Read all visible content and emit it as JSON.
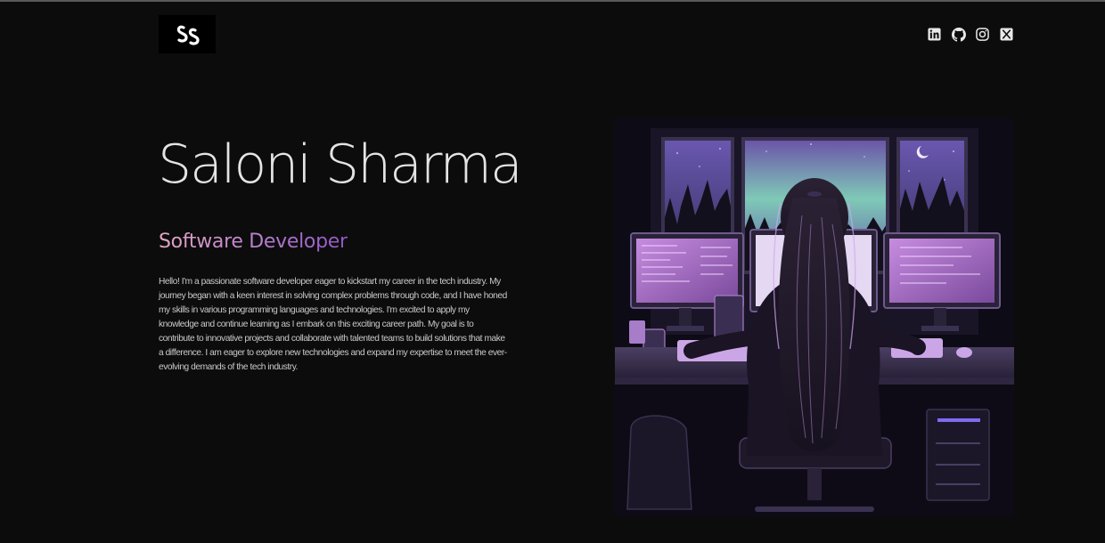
{
  "header": {
    "logo_text": "SS",
    "logo_icon": "ss-monogram-logo",
    "socials": [
      {
        "name": "LinkedIn",
        "icon": "linkedin-icon"
      },
      {
        "name": "GitHub",
        "icon": "github-icon"
      },
      {
        "name": "Instagram",
        "icon": "instagram-icon"
      },
      {
        "name": "X",
        "icon": "x-icon"
      }
    ]
  },
  "hero": {
    "name": "Saloni Sharma",
    "role": "Software Developer",
    "bio": "Hello! I'm a passionate software developer eager to kickstart my career in the tech industry. My journey began with a keen interest in solving complex problems through code, and I have honed my skills in various programming languages and technologies. I'm excited to apply my knowledge and continue learning as I embark on this exciting career path. My goal is to contribute to innovative projects and collaborate with talented teams to build solutions that make a difference. I am eager to explore new technologies and expand my expertise to meet the ever-evolving demands of the tech industry.",
    "illustration": "developer-at-desk-illustration"
  },
  "colors": {
    "background": "#0c0c0c",
    "text": "#e4e4e4",
    "role_gradient_start": "#e4a6c2",
    "role_gradient_end": "#9155c6",
    "accent_purple": "#b07ad6"
  }
}
